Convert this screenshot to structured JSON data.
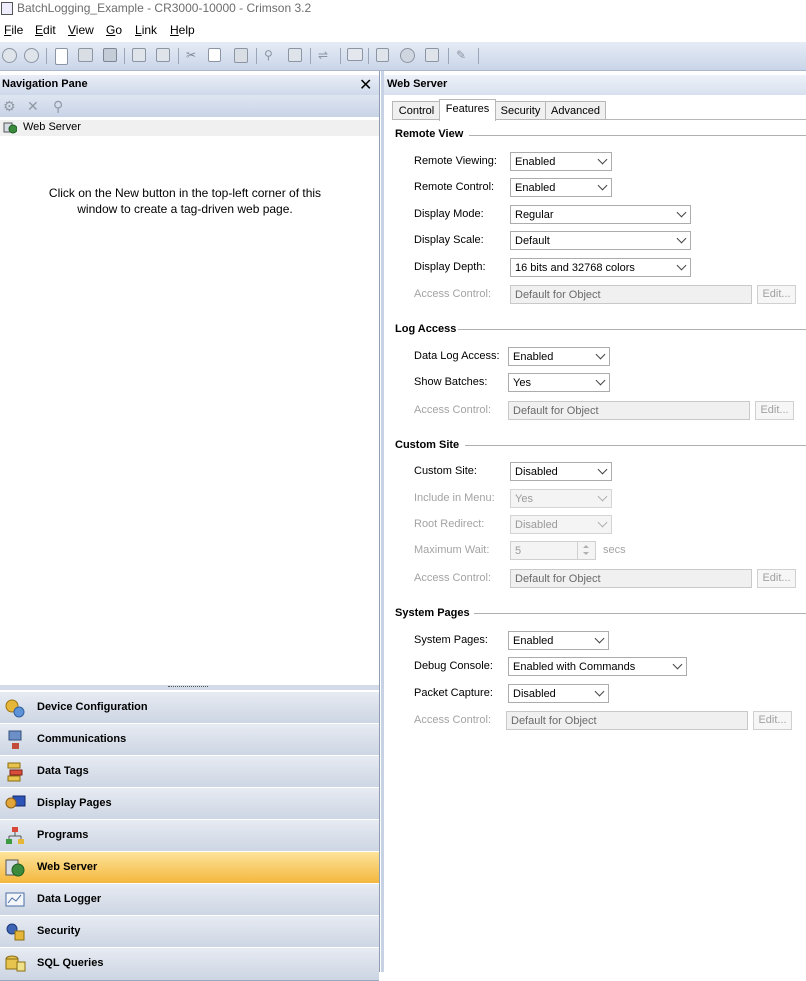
{
  "window": {
    "title": "BatchLogging_Example - CR3000-10000 - Crimson 3.2"
  },
  "menu": {
    "items": [
      "File",
      "Edit",
      "View",
      "Go",
      "Link",
      "Help"
    ]
  },
  "toolbar": {
    "icons": [
      "back-icon",
      "forward-icon",
      "new-file-icon",
      "open-icon",
      "save-icon",
      "import-icon",
      "export-icon",
      "cut-icon",
      "copy-icon",
      "paste-icon",
      "find-icon",
      "replace-icon",
      "link-icon",
      "monitor-icon",
      "zoom-icon",
      "gear-icon",
      "gear2-icon",
      "pen-icon"
    ]
  },
  "nav": {
    "header": "Navigation Pane",
    "close_glyph": "✕",
    "tree_item": "Web Server",
    "message": "Click on the New button in the top-left corner of this window to create a tag-driven web page.",
    "categories": [
      {
        "label": "Device Configuration",
        "icon": "device-config-icon",
        "active": false
      },
      {
        "label": "Communications",
        "icon": "communications-icon",
        "active": false
      },
      {
        "label": "Data Tags",
        "icon": "data-tags-icon",
        "active": false
      },
      {
        "label": "Display Pages",
        "icon": "display-pages-icon",
        "active": false
      },
      {
        "label": "Programs",
        "icon": "programs-icon",
        "active": false
      },
      {
        "label": "Web Server",
        "icon": "web-server-icon",
        "active": true
      },
      {
        "label": "Data Logger",
        "icon": "data-logger-icon",
        "active": false
      },
      {
        "label": "Security",
        "icon": "security-icon",
        "active": false
      },
      {
        "label": "SQL Queries",
        "icon": "sql-queries-icon",
        "active": false
      }
    ]
  },
  "panel": {
    "title": "Web Server",
    "tabs": [
      "Control",
      "Features",
      "Security",
      "Advanced"
    ],
    "active_tab": "Features",
    "edit_label": "Edit...",
    "remote_view": {
      "heading": "Remote View",
      "remote_viewing_label": "Remote Viewing:",
      "remote_viewing": "Enabled",
      "remote_control_label": "Remote Control:",
      "remote_control": "Enabled",
      "display_mode_label": "Display Mode:",
      "display_mode": "Regular",
      "display_scale_label": "Display Scale:",
      "display_scale": "Default",
      "display_depth_label": "Display Depth:",
      "display_depth": "16 bits and 32768 colors",
      "access_control_label": "Access Control:",
      "access_control": "Default for Object"
    },
    "log_access": {
      "heading": "Log Access",
      "data_log_access_label": "Data Log Access:",
      "data_log_access": "Enabled",
      "show_batches_label": "Show Batches:",
      "show_batches": "Yes",
      "access_control_label": "Access Control:",
      "access_control": "Default for Object"
    },
    "custom_site": {
      "heading": "Custom Site",
      "custom_site_label": "Custom Site:",
      "custom_site": "Disabled",
      "include_in_menu_label": "Include in Menu:",
      "include_in_menu": "Yes",
      "root_redirect_label": "Root Redirect:",
      "root_redirect": "Disabled",
      "maximum_wait_label": "Maximum Wait:",
      "maximum_wait": "5",
      "maximum_wait_unit": "secs",
      "access_control_label": "Access Control:",
      "access_control": "Default for Object"
    },
    "system_pages": {
      "heading": "System Pages",
      "system_pages_label": "System Pages:",
      "system_pages": "Enabled",
      "debug_console_label": "Debug Console:",
      "debug_console": "Enabled with Commands",
      "packet_capture_label": "Packet Capture:",
      "packet_capture": "Disabled",
      "access_control_label": "Access Control:",
      "access_control": "Default for Object"
    }
  }
}
